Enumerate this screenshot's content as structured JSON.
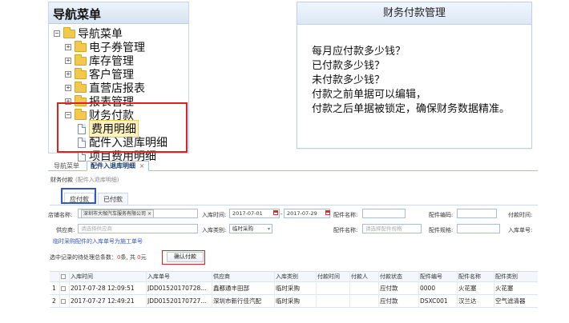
{
  "tree": {
    "title": "导航菜单",
    "root": "导航菜单",
    "nodes": [
      "电子券管理",
      "库存管理",
      "客户管理",
      "直营店报表",
      "报表管理"
    ],
    "finance": {
      "label": "财务付款",
      "children": [
        "费用明细",
        "配件入退库明细",
        "项目费用明细"
      ],
      "selected": "费用明细"
    }
  },
  "description": {
    "title": "财务付款管理",
    "lines": [
      "每月应付款多少钱？",
      "已付款多少钱？",
      "未付款多少钱？",
      "付款之前单据可以编辑，",
      "付款之后单据被锁定，确保财务数据精准。"
    ]
  },
  "app": {
    "tabs": [
      {
        "label": "导航菜单",
        "active": false
      },
      {
        "label": "配件入退库明细",
        "active": true,
        "close": "×"
      }
    ],
    "breadcrumb": {
      "title": "财务付款",
      "sub": "(配件入退库明细)"
    },
    "subtabs": [
      {
        "label": "应付款",
        "active": true
      },
      {
        "label": "已付款",
        "active": false
      }
    ],
    "filters": {
      "store_label": "店铺名称:",
      "store_chip": "深圳市大咖汽车服务有限公司",
      "store_chip_close": "×",
      "instock_time_label": "入库时间:",
      "date_from": "2017-07-01",
      "date_sep": "-",
      "date_to": "2017-07-29",
      "part_name_label": "配件名称:",
      "part_code_label": "配件编码:",
      "pay_time_label": "付款时间:",
      "supplier_label": "供应商:",
      "supplier_placeholder": "请选择供应商",
      "instock_type_label": "入库类别:",
      "instock_type_value": "临时采购",
      "part_name2_label": "配件名称:",
      "part_name_placeholder": "请选择配件规格",
      "part_spec_label": "配件规格:",
      "instock_no_label": "入库单号:"
    },
    "notice": "临时采购配件的入库单号为施工单号",
    "summary": {
      "prefix": "选中记录的待处理总条数：",
      "count": "0",
      "mid": "条, 共 ",
      "amount": "0",
      "suffix": "元"
    },
    "confirm_button": "确认付款",
    "grid": {
      "headers": [
        "入库时间",
        "入库单号",
        "供应商",
        "入库类别",
        "付款时间",
        "付款人",
        "付款状态",
        "配件编号",
        "配件名称",
        "配件类别"
      ],
      "rows": [
        {
          "num": "1",
          "cells": [
            "2017-07-28 12:09:51",
            "JDD01520170728...",
            "鑫都通丰田部",
            "临时采购",
            "",
            "",
            "应付款",
            "0000",
            "火花塞",
            "火花塞"
          ]
        },
        {
          "num": "2",
          "cells": [
            "2017-07-27 12:49:21",
            "JDD01520170727...",
            "深圳市新行佳汽配",
            "临时采购",
            "",
            "",
            "应付款",
            "DSXC001",
            "汉兰达",
            "空气滤清器"
          ]
        }
      ]
    }
  }
}
